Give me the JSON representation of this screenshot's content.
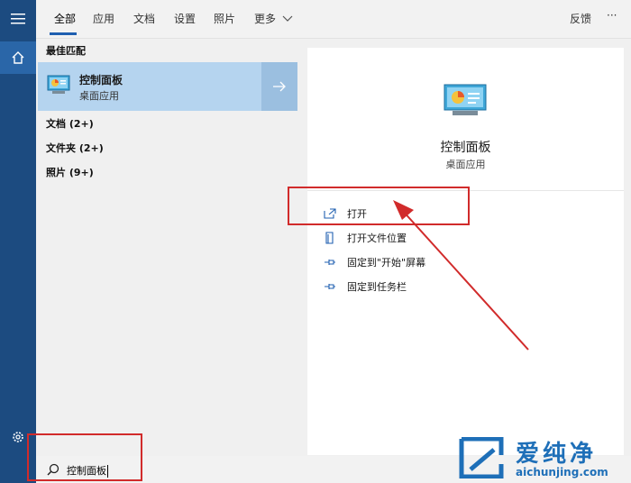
{
  "tabs": [
    "全部",
    "应用",
    "文档",
    "设置",
    "照片",
    "更多"
  ],
  "feedback_label": "反馈",
  "more_options_label": "···",
  "best_match": {
    "header": "最佳匹配",
    "title": "控制面板",
    "subtitle": "桌面应用"
  },
  "categories": [
    "文档 (2+)",
    "文件夹 (2+)",
    "照片 (9+)"
  ],
  "detail": {
    "title": "控制面板",
    "subtitle": "桌面应用",
    "actions": [
      "打开",
      "打开文件位置",
      "固定到\"开始\"屏幕",
      "固定到任务栏"
    ]
  },
  "search": {
    "value": "控制面板"
  },
  "watermark": {
    "text_cn": "爱纯净",
    "url": "aichunjing.com"
  },
  "colors": {
    "accent": "#1f5fb0",
    "rail": "#1c4b80",
    "selection": "#b5d4ef",
    "annotation": "#d12b2b"
  }
}
